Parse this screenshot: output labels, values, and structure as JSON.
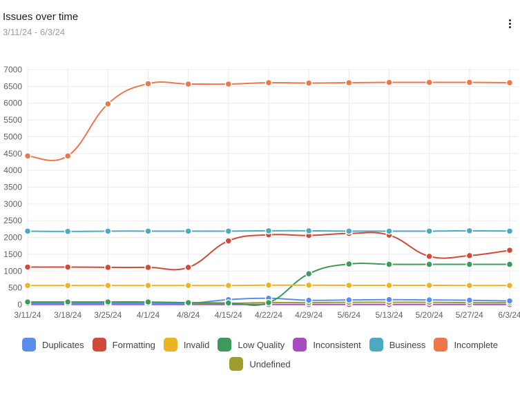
{
  "header": {
    "title": "Issues over time",
    "subtitle": "3/11/24 - 6/3/24",
    "menu_icon": "more-vert-icon"
  },
  "chart_data": {
    "type": "line",
    "title": "Issues over time",
    "subtitle": "3/11/24 - 6/3/24",
    "xlabel": "",
    "ylabel": "",
    "x": [
      "3/11/24",
      "3/18/24",
      "3/25/24",
      "4/1/24",
      "4/8/24",
      "4/15/24",
      "4/22/24",
      "4/29/24",
      "5/6/24",
      "5/13/24",
      "5/20/24",
      "5/27/24",
      "6/3/24"
    ],
    "ylim": [
      0,
      7000
    ],
    "yticks": [
      0,
      500,
      1000,
      1500,
      2000,
      2500,
      3000,
      3500,
      4000,
      4500,
      5000,
      5500,
      6000,
      6500,
      7000
    ],
    "grid": true,
    "legend_position": "bottom",
    "series": [
      {
        "name": "Inconsistent",
        "color": "#a64dbf",
        "values": [
          5,
          5,
          5,
          5,
          5,
          5,
          5,
          5,
          5,
          5,
          5,
          5,
          5
        ]
      },
      {
        "name": "Undefined",
        "color": "#9e9d2f",
        "values": [
          30,
          30,
          30,
          30,
          30,
          40,
          60,
          60,
          70,
          70,
          70,
          60,
          60
        ]
      },
      {
        "name": "Duplicates",
        "color": "#5b8def",
        "values": [
          40,
          40,
          40,
          40,
          40,
          150,
          190,
          130,
          140,
          150,
          140,
          130,
          110
        ]
      },
      {
        "name": "Low Quality",
        "color": "#3d9a5a",
        "values": [
          80,
          80,
          80,
          80,
          60,
          50,
          60,
          920,
          1210,
          1200,
          1200,
          1200,
          1200
        ]
      },
      {
        "name": "Invalid",
        "color": "#ecb424",
        "values": [
          570,
          570,
          570,
          570,
          570,
          570,
          580,
          580,
          575,
          575,
          575,
          570,
          570
        ]
      },
      {
        "name": "Formatting",
        "color": "#cf4a3b",
        "values": [
          1120,
          1120,
          1110,
          1110,
          1110,
          1900,
          2080,
          2060,
          2120,
          2070,
          1440,
          1460,
          1620
        ]
      },
      {
        "name": "Business",
        "color": "#4ba9c2",
        "values": [
          2190,
          2180,
          2190,
          2190,
          2190,
          2190,
          2200,
          2200,
          2190,
          2190,
          2190,
          2200,
          2190
        ]
      },
      {
        "name": "Incomplete",
        "color": "#f07548",
        "values": [
          4430,
          4430,
          5980,
          6580,
          6570,
          6570,
          6610,
          6600,
          6610,
          6620,
          6620,
          6620,
          6610
        ]
      }
    ]
  },
  "legend": {
    "row1": [
      {
        "label": "Duplicates",
        "color": "#5b8def"
      },
      {
        "label": "Formatting",
        "color": "#cf4a3b"
      },
      {
        "label": "Invalid",
        "color": "#ecb424"
      },
      {
        "label": "Low Quality",
        "color": "#3d9a5a"
      },
      {
        "label": "Inconsistent",
        "color": "#a64dbf"
      },
      {
        "label": "Business",
        "color": "#4ba9c2"
      },
      {
        "label": "Incomplete",
        "color": "#f07548"
      }
    ],
    "row2": [
      {
        "label": "Undefined",
        "color": "#9e9d2f"
      }
    ]
  }
}
